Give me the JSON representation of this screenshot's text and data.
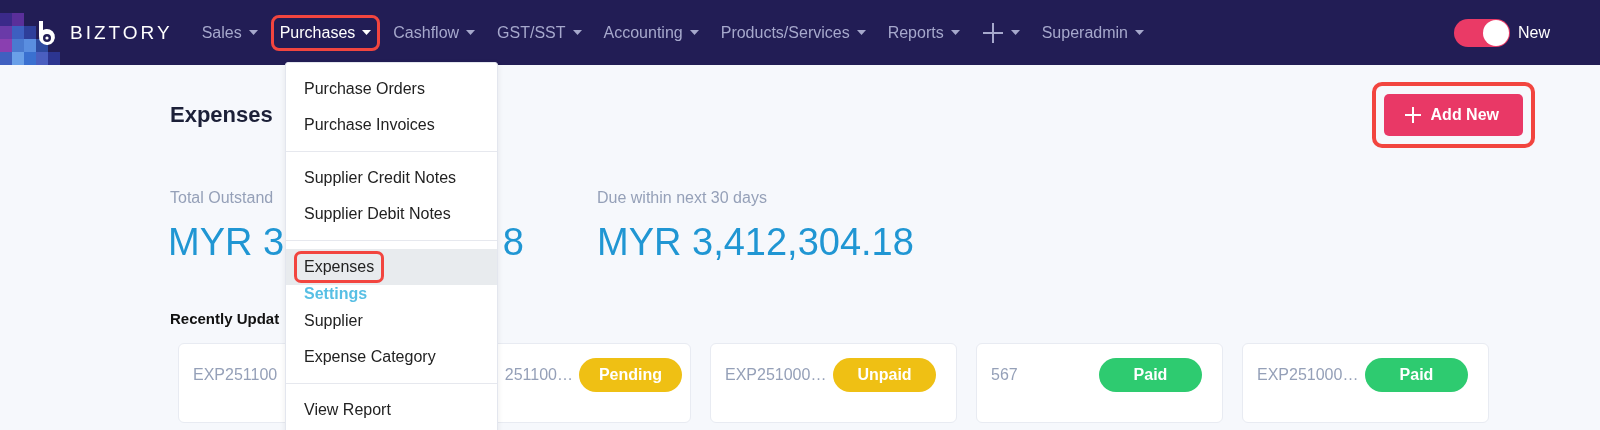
{
  "nav": {
    "logo": "BIZTORY",
    "items": [
      {
        "kind": "text",
        "label": "Sales",
        "selected": false,
        "highlighted": false
      },
      {
        "kind": "text",
        "label": "Purchases",
        "selected": true,
        "highlighted": true
      },
      {
        "kind": "text",
        "label": "Cashflow",
        "selected": false,
        "highlighted": false
      },
      {
        "kind": "text",
        "label": "GST/SST",
        "selected": false,
        "highlighted": false
      },
      {
        "kind": "text",
        "label": "Accounting",
        "selected": false,
        "highlighted": false
      },
      {
        "kind": "text",
        "label": "Products/Services",
        "selected": false,
        "highlighted": false
      },
      {
        "kind": "text",
        "label": "Reports",
        "selected": false,
        "highlighted": false
      },
      {
        "kind": "plus",
        "selected": false,
        "highlighted": false
      },
      {
        "kind": "text",
        "label": "Superadmin",
        "selected": false,
        "highlighted": false
      }
    ],
    "toggle": {
      "on": true,
      "label": "New"
    }
  },
  "dropdown": {
    "items": [
      {
        "kind": "item",
        "label": "Purchase Orders",
        "selected": false,
        "highlighted": false
      },
      {
        "kind": "item",
        "label": "Purchase Invoices",
        "selected": false,
        "highlighted": false
      },
      {
        "kind": "divider"
      },
      {
        "kind": "item",
        "label": "Supplier Credit Notes",
        "selected": false,
        "highlighted": false
      },
      {
        "kind": "item",
        "label": "Supplier Debit Notes",
        "selected": false,
        "highlighted": false
      },
      {
        "kind": "divider"
      },
      {
        "kind": "item",
        "label": "Expenses",
        "selected": true,
        "highlighted": true
      },
      {
        "kind": "heading",
        "label": "Settings"
      },
      {
        "kind": "item",
        "label": "Supplier",
        "selected": false,
        "highlighted": false
      },
      {
        "kind": "item",
        "label": "Expense Category",
        "selected": false,
        "highlighted": false
      },
      {
        "kind": "divider"
      },
      {
        "kind": "item",
        "label": "View Report",
        "selected": false,
        "highlighted": false
      }
    ]
  },
  "page": {
    "title": "Expenses",
    "add_button": {
      "label": "Add New",
      "highlighted": true
    }
  },
  "stats": [
    {
      "label": "Total Outstand",
      "amount_parts": [
        "MYR 3",
        "8"
      ]
    },
    {
      "label": "Due within next 30 days",
      "amount_parts": [
        "MYR 3,412,304.18"
      ]
    }
  ],
  "recent": {
    "title": "Recently Updat",
    "cards": [
      {
        "number": "EXP251100"
      },
      {
        "number": "251100…",
        "status": "Pending",
        "color": "#efc014"
      },
      {
        "number": "EXP251000…",
        "status": "Unpaid",
        "color": "#efc014"
      },
      {
        "number": "567",
        "status": "Paid",
        "color": "#2ecb70"
      },
      {
        "number": "EXP251000…",
        "status": "Paid",
        "color": "#2ecb70"
      }
    ]
  }
}
